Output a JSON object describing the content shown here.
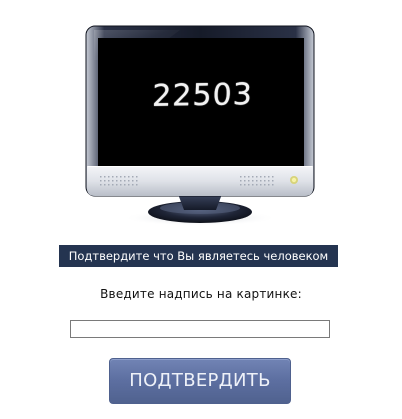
{
  "captcha": {
    "code": "22503"
  },
  "banner": {
    "text": "Подтвердите что Вы являетесь человеком"
  },
  "form": {
    "prompt": "Введите надпись на картинке:",
    "input_value": "",
    "submit_label": "ПОДТВЕРДИТЬ"
  },
  "colors": {
    "banner_bg": "#243450",
    "button_bg": "#5d6fa1",
    "screen_bg": "#000000",
    "bezel": "#1e2436"
  },
  "icons": {
    "monitor": "monitor-icon",
    "power_led": "power-led-icon"
  }
}
